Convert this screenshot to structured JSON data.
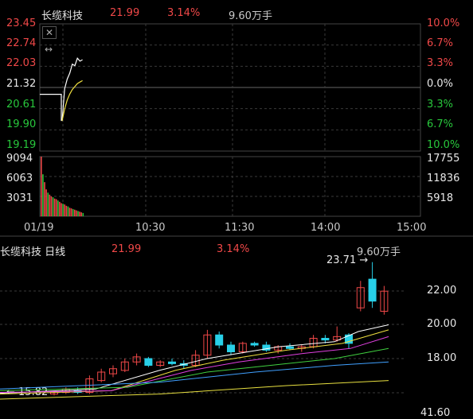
{
  "intraday": {
    "header": {
      "name": "长缆科技",
      "price": "21.99",
      "pct": "3.14%",
      "volume": "9.60万手"
    },
    "price_axis_left": [
      "23.45",
      "22.74",
      "22.03",
      "21.32",
      "20.61",
      "19.90",
      "19.19"
    ],
    "price_axis_right": [
      "10.0%",
      "6.7%",
      "3.3%",
      "0.0%",
      "3.3%",
      "6.7%",
      "10.0%"
    ],
    "volume_axis_left": [
      "9094",
      "6063",
      "3031"
    ],
    "volume_axis_right": [
      "17755",
      "11836",
      "5918"
    ],
    "time_labels": [
      "01/19",
      "10:30",
      "11:30",
      "14:00",
      "15:00"
    ],
    "icons": {
      "close": "close-icon",
      "expand": "expand-arrows-icon"
    }
  },
  "daily": {
    "header": {
      "name": "长缆科技 日线",
      "price": "21.99",
      "pct": "3.14%",
      "volume": "9.60万手"
    },
    "price_axis": [
      "22.00",
      "20.00",
      "18.00"
    ],
    "bottom_label": "41.60",
    "annotation_high": "23.71",
    "annotation_low": "15.82"
  },
  "colors": {
    "up": "#f04848",
    "down": "#28d0e8",
    "ma5": "#ffffff",
    "ma10": "#f0e040",
    "ma20": "#e040e0",
    "ma30": "#40d040",
    "ma60": "#40a0ff",
    "grid": "#3a3a3a"
  },
  "chart_data": [
    {
      "type": "line",
      "title": "长缆科技",
      "xlabel": "",
      "ylabel": "",
      "ylim": [
        19.19,
        23.45
      ],
      "series": [
        {
          "name": "",
          "values": [
            21.09,
            21.09,
            21.09,
            21.09,
            20.2,
            21.28,
            21.6,
            21.8,
            22.1,
            22.05,
            22.3,
            22.2,
            22.25
          ]
        },
        {
          "name": "",
          "values": [
            20.2,
            20.6,
            20.9,
            21.1,
            21.25,
            21.35,
            21.45,
            21.5,
            21.55
          ]
        }
      ]
    },
    {
      "type": "bar",
      "title": "",
      "ylim": [
        0,
        9094
      ],
      "values": [
        9094,
        6400,
        5200,
        4100,
        3600,
        3300,
        3031,
        2900,
        2700,
        2600,
        2400,
        2200,
        2000,
        1900,
        1800,
        1600,
        1500,
        1300,
        1200,
        1100,
        1000,
        900,
        800,
        700,
        600,
        500
      ]
    },
    {
      "type": "bar",
      "title": "长缆科技 日线",
      "ylim": [
        15.5,
        24.0
      ],
      "series": [
        {
          "name": "",
          "values": [
            {
              "o": 15.9,
              "h": 16.1,
              "l": 15.82,
              "c": 16.0
            },
            {
              "o": 16.0,
              "h": 16.3,
              "l": 15.9,
              "c": 16.2
            },
            {
              "o": 16.1,
              "h": 16.3,
              "l": 15.9,
              "c": 16.0
            },
            {
              "o": 16.0,
              "h": 17.0,
              "l": 15.9,
              "c": 16.8
            },
            {
              "o": 16.7,
              "h": 17.4,
              "l": 16.6,
              "c": 17.2
            },
            {
              "o": 17.1,
              "h": 17.6,
              "l": 16.9,
              "c": 17.4
            },
            {
              "o": 17.3,
              "h": 18.0,
              "l": 17.2,
              "c": 17.8
            },
            {
              "o": 17.8,
              "h": 18.3,
              "l": 17.6,
              "c": 18.1
            },
            {
              "o": 18.0,
              "h": 18.1,
              "l": 17.5,
              "c": 17.6
            },
            {
              "o": 17.6,
              "h": 17.9,
              "l": 17.5,
              "c": 17.8
            },
            {
              "o": 17.8,
              "h": 18.0,
              "l": 17.6,
              "c": 17.7
            },
            {
              "o": 17.7,
              "h": 17.9,
              "l": 17.4,
              "c": 17.6
            },
            {
              "o": 17.6,
              "h": 18.5,
              "l": 17.5,
              "c": 18.2
            },
            {
              "o": 18.2,
              "h": 19.7,
              "l": 18.0,
              "c": 19.4
            },
            {
              "o": 19.4,
              "h": 19.6,
              "l": 18.6,
              "c": 18.8
            },
            {
              "o": 18.8,
              "h": 19.0,
              "l": 18.2,
              "c": 18.4
            },
            {
              "o": 18.4,
              "h": 19.0,
              "l": 18.3,
              "c": 18.9
            },
            {
              "o": 18.9,
              "h": 19.0,
              "l": 18.7,
              "c": 18.8
            },
            {
              "o": 18.8,
              "h": 19.0,
              "l": 18.4,
              "c": 18.5
            },
            {
              "o": 18.5,
              "h": 18.8,
              "l": 18.3,
              "c": 18.7
            },
            {
              "o": 18.7,
              "h": 18.9,
              "l": 18.5,
              "c": 18.6
            },
            {
              "o": 18.6,
              "h": 18.8,
              "l": 18.4,
              "c": 18.7
            },
            {
              "o": 18.7,
              "h": 19.4,
              "l": 18.6,
              "c": 19.2
            },
            {
              "o": 19.2,
              "h": 19.4,
              "l": 18.9,
              "c": 19.1
            },
            {
              "o": 19.1,
              "h": 19.9,
              "l": 19.0,
              "c": 19.3
            },
            {
              "o": 19.4,
              "h": 19.5,
              "l": 18.6,
              "c": 18.9
            },
            {
              "o": 21.0,
              "h": 22.6,
              "l": 20.8,
              "c": 22.2
            },
            {
              "o": 22.7,
              "h": 23.71,
              "l": 21.0,
              "c": 21.4
            },
            {
              "o": 20.8,
              "h": 22.3,
              "l": 20.6,
              "c": 21.99
            }
          ]
        }
      ]
    }
  ]
}
